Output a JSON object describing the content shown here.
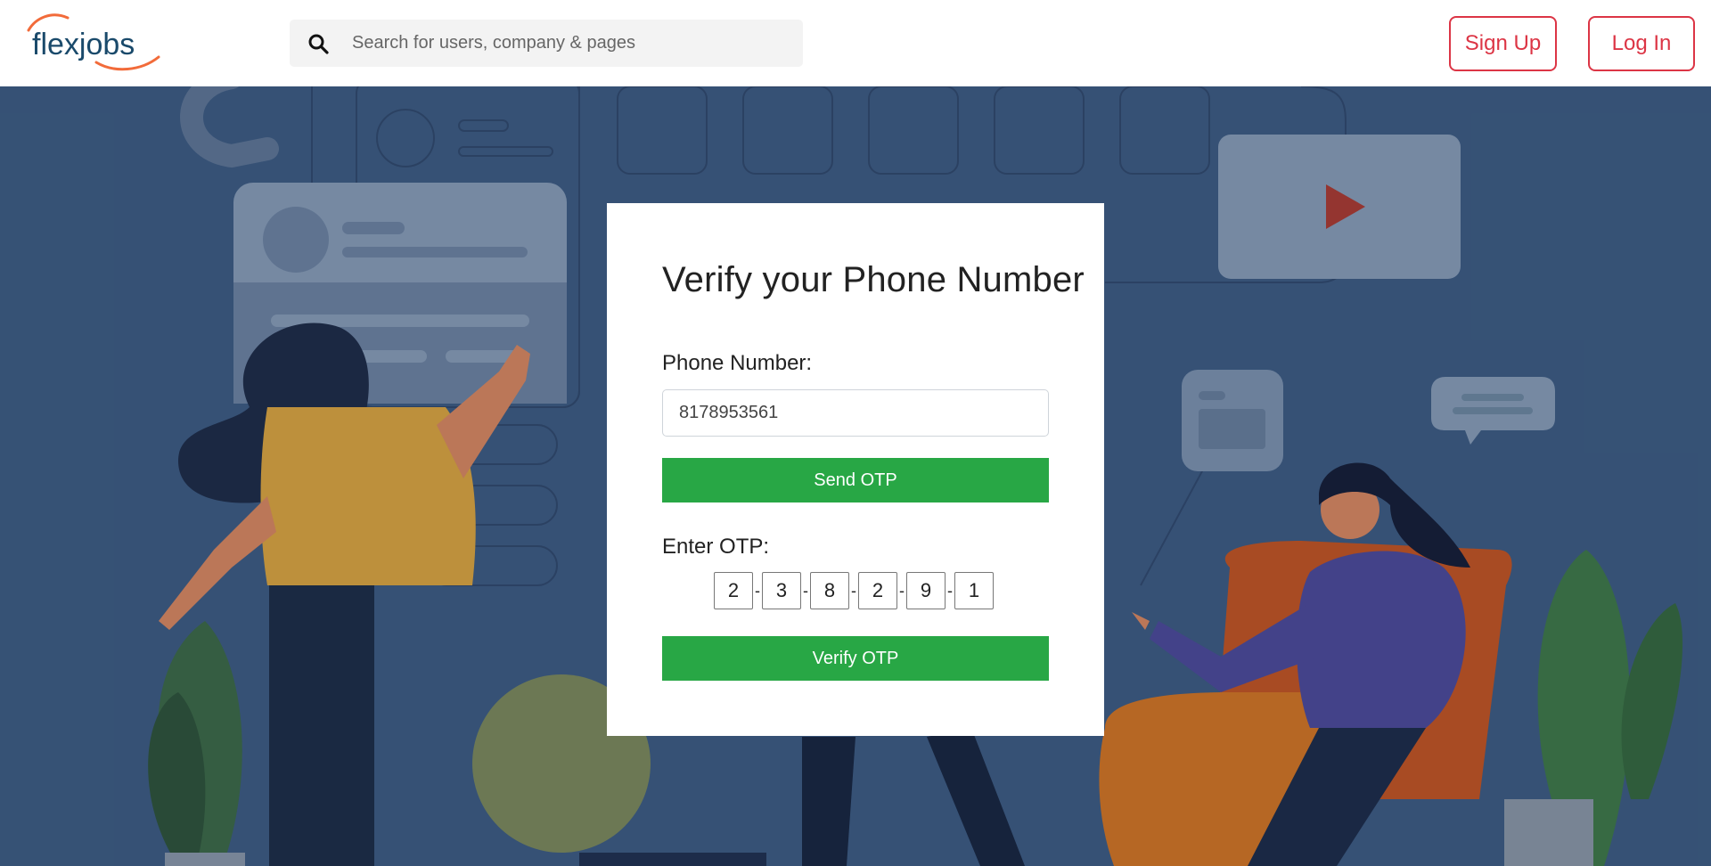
{
  "header": {
    "logo_text": "flexjobs",
    "search_placeholder": "Search for users, company & pages",
    "signup_label": "Sign Up",
    "login_label": "Log In"
  },
  "icons": {
    "search": "magnifier-icon",
    "play": "play-icon"
  },
  "colors": {
    "brand_teal": "#1a4a6b",
    "brand_orange": "#f26b3a",
    "accent_red": "#dc3545",
    "button_green": "#28a745",
    "hero_bg": "#3d5c82"
  },
  "card": {
    "title": "Verify your Phone Number",
    "phone_label": "Phone Number:",
    "phone_value": "8178953561",
    "send_label": "Send OTP",
    "otp_label": "Enter OTP:",
    "otp_digits": [
      "2",
      "3",
      "8",
      "2",
      "9",
      "1"
    ],
    "otp_separator": "-",
    "verify_label": "Verify OTP"
  }
}
